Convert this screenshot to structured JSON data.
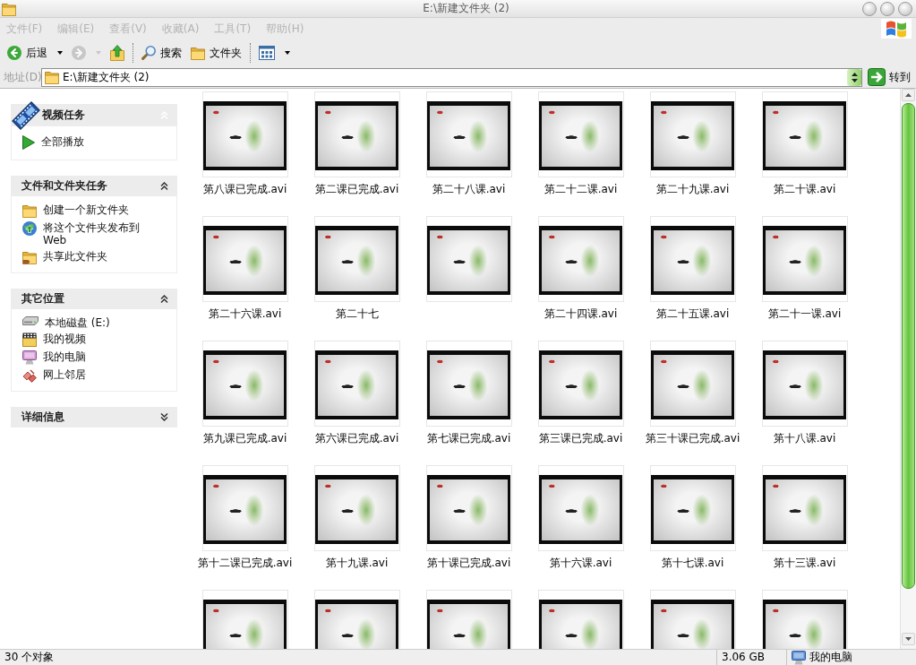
{
  "window": {
    "title": "E:\\新建文件夹 (2)"
  },
  "menu": [
    {
      "label": "文件(F)",
      "disabled": true
    },
    {
      "label": "编辑(E)",
      "disabled": true
    },
    {
      "label": "查看(V)",
      "disabled": true
    },
    {
      "label": "收藏(A)",
      "disabled": true
    },
    {
      "label": "工具(T)",
      "disabled": true
    },
    {
      "label": "帮助(H)",
      "disabled": true
    }
  ],
  "toolbar": [
    [
      {
        "kind": "back",
        "label": "后退",
        "dropdown": true,
        "disabled": false
      },
      {
        "kind": "forward",
        "dropdown": true,
        "disabled": true
      },
      {
        "kind": "up",
        "dropdown": false,
        "disabled": false
      }
    ],
    [
      {
        "kind": "search",
        "label": "搜索",
        "dropdown": false,
        "disabled": false
      },
      {
        "kind": "folders",
        "label": "文件夹",
        "dropdown": false,
        "disabled": false
      }
    ],
    [
      {
        "kind": "views",
        "dropdown": true,
        "disabled": false
      }
    ]
  ],
  "address_bar": {
    "label": "地址(D)",
    "value": "E:\\新建文件夹 (2)",
    "go_label": "转到"
  },
  "task_pane": [
    {
      "kind": "featured",
      "title": "视频任务",
      "expanded": true,
      "items": [
        {
          "kind": "play",
          "label": "全部播放"
        }
      ]
    },
    {
      "kind": "plain",
      "title": "文件和文件夹任务",
      "expanded": true,
      "items": [
        {
          "kind": "new-folder",
          "label": "创建一个新文件夹"
        },
        {
          "kind": "publish",
          "label": "将这个文件夹发布到 Web"
        },
        {
          "kind": "share",
          "label": "共享此文件夹"
        }
      ]
    },
    {
      "kind": "plain",
      "title": "其它位置",
      "expanded": true,
      "items": [
        {
          "kind": "drive",
          "label": "本地磁盘 (E:)"
        },
        {
          "kind": "videos",
          "label": "我的视频"
        },
        {
          "kind": "computer",
          "label": "我的电脑"
        },
        {
          "kind": "network",
          "label": "网上邻居"
        }
      ]
    },
    {
      "kind": "plain",
      "title": "详细信息",
      "expanded": false
    }
  ],
  "files": [
    {
      "label": "第八课已完成.avi",
      "selected": false
    },
    {
      "label": "第二课已完成.avi",
      "selected": false
    },
    {
      "label": "第二十八课.avi",
      "selected": false
    },
    {
      "label": "第二十二课.avi",
      "selected": false
    },
    {
      "label": "第二十九课.avi",
      "selected": false
    },
    {
      "label": "第二十课.avi",
      "selected": false
    },
    {
      "label": "第二十六课.avi",
      "selected": false
    },
    {
      "label": "第二十七",
      "selected": false
    },
    {
      "selected": false
    },
    {
      "label": "第二十四课.avi",
      "selected": false
    },
    {
      "label": "第二十五课.avi",
      "selected": false
    },
    {
      "label": "第二十一课.avi",
      "selected": false
    },
    {
      "label": "第九课已完成.avi",
      "selected": false
    },
    {
      "label": "第六课已完成.avi",
      "selected": false
    },
    {
      "label": "第七课已完成.avi",
      "selected": false
    },
    {
      "label": "第三课已完成.avi",
      "selected": false
    },
    {
      "label": "第三十课已完成.avi",
      "selected": false
    },
    {
      "label": "第十八课.avi",
      "selected": false
    },
    {
      "label": "第十二课已完成.avi",
      "selected": false
    },
    {
      "label": "第十九课.avi",
      "selected": false
    },
    {
      "label": "第十课已完成.avi",
      "selected": false
    },
    {
      "label": "第十六课.avi",
      "selected": false
    },
    {
      "label": "第十七课.avi",
      "selected": false
    },
    {
      "label": "第十三课.avi",
      "selected": false
    },
    {
      "selected": false
    },
    {
      "selected": false
    },
    {
      "selected": false
    },
    {
      "selected": false
    },
    {
      "selected": false
    },
    {
      "selected": false
    }
  ],
  "status_bar": {
    "objects": "30 个对象",
    "size": "3.06 GB",
    "location": "我的电脑"
  }
}
